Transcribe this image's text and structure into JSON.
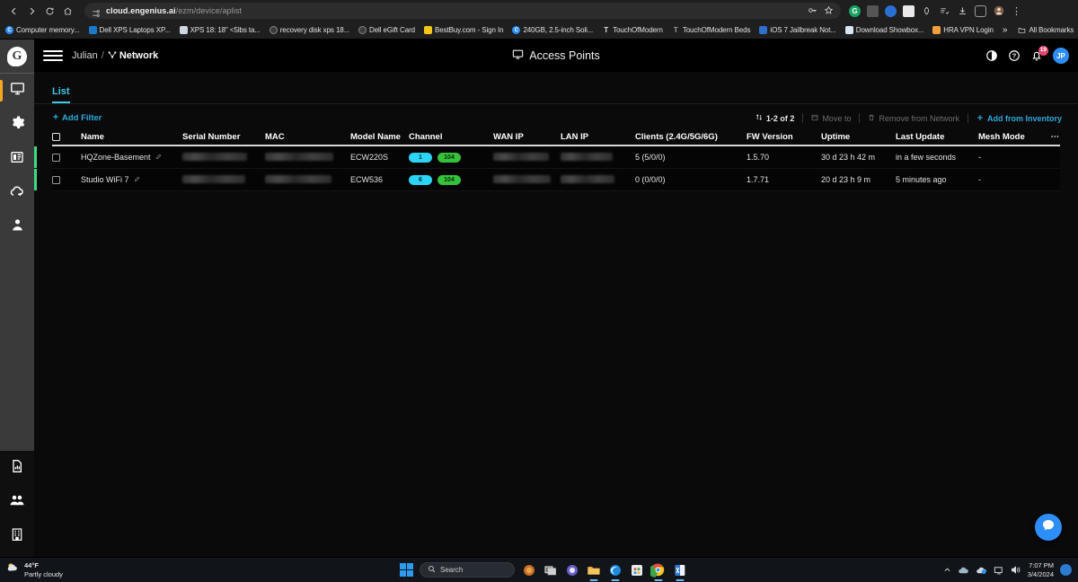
{
  "browser": {
    "back_icon": "back-arrow-icon",
    "forward_icon": "forward-arrow-icon",
    "reload_icon": "reload-icon",
    "home_icon": "home-icon",
    "url_domain": "cloud.engenius.ai",
    "url_path": "/ezm/device/aplist",
    "site_icon": "site-settings-icon",
    "key_icon": "password-key-icon",
    "star_icon": "bookmark-star-icon",
    "menu_icon": "chrome-menu-icon",
    "extensions": [
      "grammarly-icon",
      "extension-icon",
      "extension-blue-icon",
      "extension-white-icon",
      "extension-zap-icon",
      "reading-list-icon",
      "downloads-icon",
      "sidepanel-icon",
      "profile-icon"
    ],
    "bookmarks": [
      {
        "label": "Computer memory...",
        "color": "#2d8ef7",
        "glyph": "C"
      },
      {
        "label": "Dell XPS Laptops XP...",
        "color": "#1b79c9",
        "glyph": ""
      },
      {
        "label": "XPS 18: 18\" <5lbs ta...",
        "color": "#cfd6dd",
        "glyph": ""
      },
      {
        "label": "recovery disk xps 18...",
        "color": "#4b4b4b",
        "glyph": ""
      },
      {
        "label": "Dell eGift Card",
        "color": "#4b4b4b",
        "glyph": ""
      },
      {
        "label": "BestBuy.com - Sign In",
        "color": "#f5c518",
        "glyph": ""
      },
      {
        "label": "240GB, 2.5-inch Soli...",
        "color": "#2d8ef7",
        "glyph": "C"
      },
      {
        "label": "TouchOfModern",
        "color": "#dcdcdc",
        "glyph": "T"
      },
      {
        "label": "TouchOfModern Beds",
        "color": "#dcdcdc",
        "glyph": "T"
      },
      {
        "label": "iOS 7 Jailbreak Not...",
        "color": "#2f6fd0",
        "glyph": ""
      },
      {
        "label": "Download Showbox...",
        "color": "#d8e6f2",
        "glyph": ""
      },
      {
        "label": "HRA VPN Login",
        "color": "#f2a03d",
        "glyph": ""
      }
    ],
    "overflow_label": "»",
    "all_bookmarks_label": "All Bookmarks",
    "folder_icon": "folder-icon"
  },
  "app": {
    "logo_letter": "G",
    "menu_icon": "hamburger-menu-icon",
    "breadcrumb": {
      "org": "Julian",
      "separator": "/",
      "network": "Network",
      "network_icon": "network-topology-icon"
    },
    "page_title": "Access Points",
    "page_title_icon": "monitor-icon",
    "header_actions": {
      "theme_icon": "theme-contrast-icon",
      "help_icon": "help-circle-icon",
      "bell_icon": "notification-bell-icon",
      "bell_badge": "19",
      "avatar_initials": "JP"
    },
    "sidebar": [
      {
        "name": "sidebar-item-devices",
        "icon": "monitor-icon",
        "active": true
      },
      {
        "name": "sidebar-item-configure",
        "icon": "gear-icon",
        "active": false
      },
      {
        "name": "sidebar-item-dashboard",
        "icon": "dashboard-panel-icon",
        "active": false
      },
      {
        "name": "sidebar-item-cloud",
        "icon": "cloud-icon",
        "active": false
      },
      {
        "name": "sidebar-item-clients",
        "icon": "user-icon",
        "active": false
      }
    ],
    "sidebar_bottom": [
      {
        "name": "sidebar-item-reports",
        "icon": "report-chart-icon"
      },
      {
        "name": "sidebar-item-users",
        "icon": "users-icon"
      },
      {
        "name": "sidebar-item-organization",
        "icon": "building-icon"
      }
    ],
    "tabs": [
      {
        "label": "List",
        "active": true
      }
    ],
    "toolbar": {
      "add_filter_label": "Add Filter",
      "add_filter_icon": "plus-icon",
      "count_label": "1-2 of 2",
      "count_icon": "pagination-icon",
      "move_to_label": "Move to",
      "move_to_icon": "move-icon",
      "remove_label": "Remove from Network",
      "remove_icon": "trash-icon",
      "add_inventory_label": "Add from Inventory",
      "add_inventory_icon": "plus-icon"
    },
    "table": {
      "columns": [
        "Name",
        "Serial Number",
        "MAC",
        "Model Name",
        "Channel",
        "WAN IP",
        "LAN IP",
        "Clients (2.4G/5G/6G)",
        "FW Version",
        "Uptime",
        "Last Update",
        "Mesh Mode"
      ],
      "more_icon": "column-options-icon",
      "rows": [
        {
          "name": "HQZone-Basement",
          "edit_icon": "edit-pencil-icon",
          "serial": "",
          "mac": "",
          "model": "ECW220S",
          "channel_24": "1",
          "channel_5": "104",
          "wan_ip": "",
          "lan_ip": "",
          "clients": "5 (5/0/0)",
          "fw_version": "1.5.70",
          "uptime": "30 d 23 h 42 m",
          "last_update": "in a few seconds",
          "mesh_mode": "-",
          "status_color": "#3ddc84"
        },
        {
          "name": "Studio WiFi 7",
          "edit_icon": "edit-pencil-icon",
          "serial": "",
          "mac": "",
          "model": "ECW536",
          "channel_24": "6",
          "channel_5": "104",
          "wan_ip": "",
          "lan_ip": "",
          "clients": "0 (0/0/0)",
          "fw_version": "1.7.71",
          "uptime": "20 d 23 h 9 m",
          "last_update": "5 minutes ago",
          "mesh_mode": "-",
          "status_color": "#3ddc84"
        }
      ]
    },
    "chat_icon": "chat-support-icon"
  },
  "taskbar": {
    "weather_temp": "44°F",
    "weather_desc": "Partly cloudy",
    "weather_icon": "partly-cloudy-icon",
    "start_icon": "windows-start-icon",
    "search_placeholder": "Search",
    "search_icon": "search-icon",
    "apps": [
      {
        "name": "taskbar-app-widgets",
        "icon": "widgets-icon"
      },
      {
        "name": "taskbar-app-taskview",
        "icon": "task-view-icon"
      },
      {
        "name": "taskbar-app-teams",
        "icon": "teams-icon"
      },
      {
        "name": "taskbar-app-explorer",
        "icon": "file-explorer-icon"
      },
      {
        "name": "taskbar-app-edge",
        "icon": "edge-icon"
      },
      {
        "name": "taskbar-app-store",
        "icon": "microsoft-store-icon"
      },
      {
        "name": "taskbar-app-chrome",
        "icon": "chrome-icon"
      },
      {
        "name": "taskbar-app-excel",
        "icon": "excel-icon"
      }
    ],
    "tray": {
      "chevron_icon": "show-hidden-icons-icon",
      "onedrive_icon": "onedrive-icon",
      "cloud_icon": "cloud-sync-icon",
      "network_icon": "network-icon",
      "volume_icon": "volume-icon",
      "time": "7:07 PM",
      "date": "3/4/2024",
      "notification_icon": "notification-center-icon"
    }
  }
}
